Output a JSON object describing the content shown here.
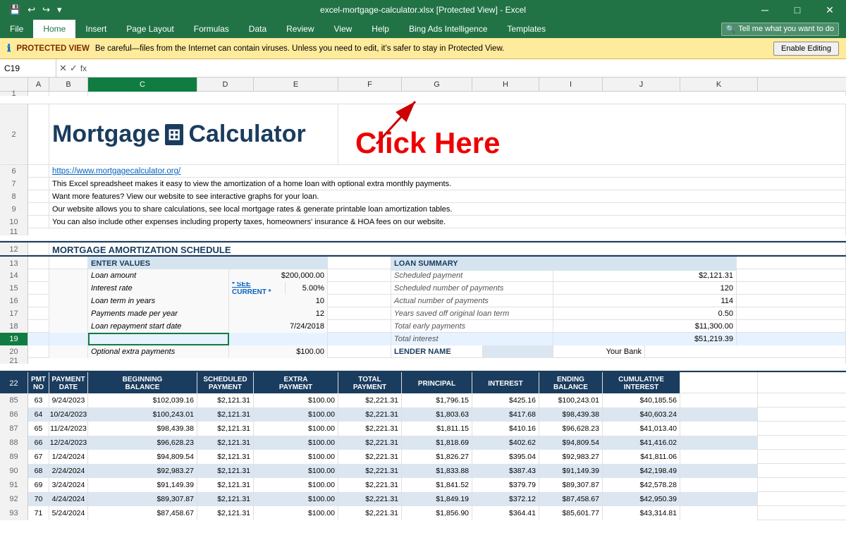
{
  "titlebar": {
    "title": "excel-mortgage-calculator.xlsx [Protected View] - Excel"
  },
  "quickaccess": {
    "save": "💾",
    "undo": "↩",
    "redo": "↪",
    "dropdown": "▾"
  },
  "ribbon": {
    "tabs": [
      "File",
      "Home",
      "Insert",
      "Page Layout",
      "Formulas",
      "Data",
      "Review",
      "View",
      "Help",
      "Bing Ads Intelligence",
      "Templates"
    ],
    "active": "Home",
    "search_placeholder": "Tell me what you want to do"
  },
  "protected_bar": {
    "icon": "ℹ",
    "label": "PROTECTED VIEW",
    "message": "Be careful—files from the Internet can contain viruses. Unless you need to edit, it's safer to stay in Protected View.",
    "button": "Enable Editing"
  },
  "formula_bar": {
    "cell_ref": "C19",
    "formula": ""
  },
  "columns": [
    "A",
    "B",
    "C",
    "D",
    "E",
    "F",
    "G",
    "H",
    "I",
    "J",
    "K"
  ],
  "header": {
    "title": "Mortgage",
    "calc_symbol": "⊞",
    "title2": "Calculator",
    "click_here": "Click Here"
  },
  "link": {
    "url": "https://www.mortgagecalculator.org/"
  },
  "description": [
    "This Excel spreadsheet makes it easy to view the amortization of a home loan with optional extra monthly payments.",
    "Want more features? View our website to see interactive graphs for your loan.",
    "Our website allows you to share calculations, see local mortgage rates & generate printable loan amortization tables.",
    "You can also include other expenses including property taxes, homeowners' insurance & HOA fees on our website."
  ],
  "section_title": "MORTGAGE AMORTIZATION SCHEDULE",
  "enter_values": {
    "header": "ENTER VALUES",
    "rows": [
      {
        "label": "Loan amount",
        "value": "$200,000.00"
      },
      {
        "label": "Interest rate",
        "link": "* SEE CURRENT *",
        "value": "5.00%"
      },
      {
        "label": "Loan term in years",
        "value": "10"
      },
      {
        "label": "Payments made per year",
        "value": "12"
      },
      {
        "label": "Loan repayment start date",
        "value": "7/24/2018"
      },
      {
        "label": "",
        "value": ""
      },
      {
        "label": "Optional extra payments",
        "value": "$100.00"
      }
    ]
  },
  "loan_summary": {
    "header": "LOAN SUMMARY",
    "rows": [
      {
        "label": "Scheduled payment",
        "value": "$2,121.31"
      },
      {
        "label": "Scheduled number of payments",
        "value": "120"
      },
      {
        "label": "Actual number of payments",
        "value": "114"
      },
      {
        "label": "Years saved off original loan term",
        "value": "0.50"
      },
      {
        "label": "Total early payments",
        "value": "$11,300.00"
      },
      {
        "label": "Total interest",
        "value": "$51,219.39"
      }
    ],
    "lender_label": "LENDER NAME",
    "lender_value": "Your Bank"
  },
  "table_headers": {
    "pmt_no": "PMT\nNO",
    "payment_date": "PAYMENT\nDATE",
    "beginning_balance": "BEGINNING\nBALANCE",
    "scheduled_payment": "SCHEDULED\nPAYMENT",
    "extra_payment": "EXTRA\nPAYMENT",
    "total_payment": "TOTAL\nPAYMENT",
    "principal": "PRINCIPAL",
    "interest": "INTEREST",
    "ending_balance": "ENDING\nBALANCE",
    "cumulative_interest": "CUMULATIVE\nINTEREST"
  },
  "table_rows": [
    {
      "row_num": "85",
      "pmt": "63",
      "date": "9/24/2023",
      "beg_bal": "$102,039.16",
      "sched": "$2,121.31",
      "extra": "$100.00",
      "total": "$2,221.31",
      "principal": "$1,796.15",
      "interest": "$425.16",
      "end_bal": "$100,243.01",
      "cum_int": "$40,185.56",
      "even": false
    },
    {
      "row_num": "86",
      "pmt": "64",
      "date": "10/24/2023",
      "beg_bal": "$100,243.01",
      "sched": "$2,121.31",
      "extra": "$100.00",
      "total": "$2,221.31",
      "principal": "$1,803.63",
      "interest": "$417.68",
      "end_bal": "$98,439.38",
      "cum_int": "$40,603.24",
      "even": true
    },
    {
      "row_num": "87",
      "pmt": "65",
      "date": "11/24/2023",
      "beg_bal": "$98,439.38",
      "sched": "$2,121.31",
      "extra": "$100.00",
      "total": "$2,221.31",
      "principal": "$1,811.15",
      "interest": "$410.16",
      "end_bal": "$96,628.23",
      "cum_int": "$41,013.40",
      "even": false
    },
    {
      "row_num": "88",
      "pmt": "66",
      "date": "12/24/2023",
      "beg_bal": "$96,628.23",
      "sched": "$2,121.31",
      "extra": "$100.00",
      "total": "$2,221.31",
      "principal": "$1,818.69",
      "interest": "$402.62",
      "end_bal": "$94,809.54",
      "cum_int": "$41,416.02",
      "even": true
    },
    {
      "row_num": "89",
      "pmt": "67",
      "date": "1/24/2024",
      "beg_bal": "$94,809.54",
      "sched": "$2,121.31",
      "extra": "$100.00",
      "total": "$2,221.31",
      "principal": "$1,826.27",
      "interest": "$395.04",
      "end_bal": "$92,983.27",
      "cum_int": "$41,811.06",
      "even": false
    },
    {
      "row_num": "90",
      "pmt": "68",
      "date": "2/24/2024",
      "beg_bal": "$92,983.27",
      "sched": "$2,121.31",
      "extra": "$100.00",
      "total": "$2,221.31",
      "principal": "$1,833.88",
      "interest": "$387.43",
      "end_bal": "$91,149.39",
      "cum_int": "$42,198.49",
      "even": true
    },
    {
      "row_num": "91",
      "pmt": "69",
      "date": "3/24/2024",
      "beg_bal": "$91,149.39",
      "sched": "$2,121.31",
      "extra": "$100.00",
      "total": "$2,221.31",
      "principal": "$1,841.52",
      "interest": "$379.79",
      "end_bal": "$89,307.87",
      "cum_int": "$42,578.28",
      "even": false
    },
    {
      "row_num": "92",
      "pmt": "70",
      "date": "4/24/2024",
      "beg_bal": "$89,307.87",
      "sched": "$2,121.31",
      "extra": "$100.00",
      "total": "$2,221.31",
      "principal": "$1,849.19",
      "interest": "$372.12",
      "end_bal": "$87,458.67",
      "cum_int": "$42,950.39",
      "even": true
    },
    {
      "row_num": "93",
      "pmt": "71",
      "date": "5/24/2024",
      "beg_bal": "$87,458.67",
      "sched": "$2,121.31",
      "extra": "$100.00",
      "total": "$2,221.31",
      "principal": "$1,856.90",
      "interest": "$364.41",
      "end_bal": "$85,601.77",
      "cum_int": "$43,314.81",
      "even": false
    }
  ]
}
